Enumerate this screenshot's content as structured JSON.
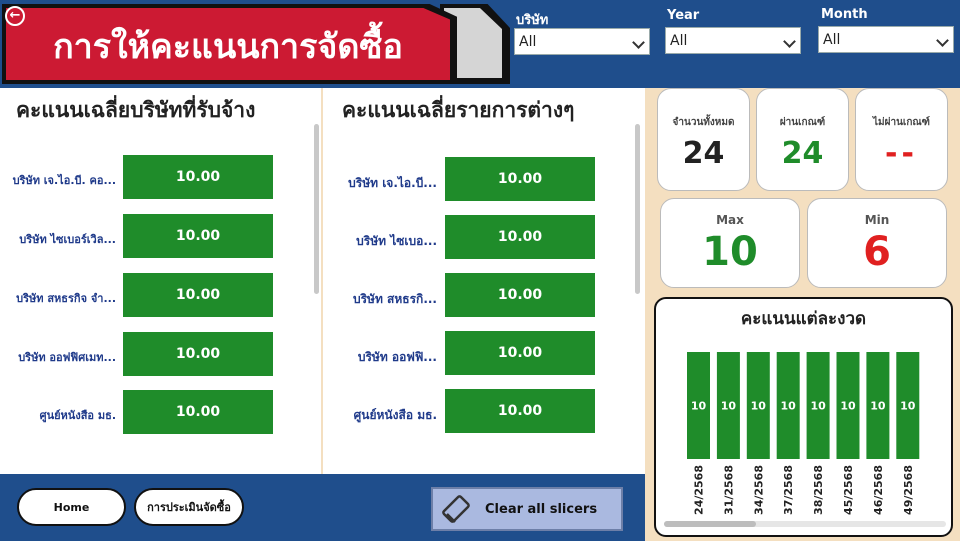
{
  "header": {
    "title": "การให้คะแนนการจัดซื้อ",
    "colors": {
      "band": "#1f4e8c",
      "title_bg": "#cc1a33"
    }
  },
  "filters": [
    {
      "label": "บริษัท",
      "value": "All"
    },
    {
      "label": "Year",
      "value": "All"
    },
    {
      "label": "Month",
      "value": "All"
    }
  ],
  "left_table": {
    "title": "คะแนนเฉลี่ยบริษัทที่รับจ้าง",
    "rows": [
      {
        "label": "บริษัท เจ.ไอ.บี. คอ...",
        "value": "10.00"
      },
      {
        "label": "บริษัท ไซเบอร์เวิล...",
        "value": "10.00"
      },
      {
        "label": "บริษัท สหธรกิจ จำ...",
        "value": "10.00"
      },
      {
        "label": "บริษัท ออฟฟิศเมท...",
        "value": "10.00"
      },
      {
        "label": "ศูนย์หนังสือ มธ.",
        "value": "10.00"
      }
    ]
  },
  "right_table": {
    "title": "คะแนนเฉลี่ยรายการต่างๆ",
    "rows": [
      {
        "label": "บริษัท เจ.ไอ.บี...",
        "value": "10.00"
      },
      {
        "label": "บริษัท ไซเบอ...",
        "value": "10.00"
      },
      {
        "label": "บริษัท สหธรกิ...",
        "value": "10.00"
      },
      {
        "label": "บริษัท ออฟฟิ...",
        "value": "10.00"
      },
      {
        "label": "ศูนย์หนังสือ มธ.",
        "value": "10.00"
      }
    ]
  },
  "nav": {
    "home": "Home",
    "evaluation": "การประเมินจัดซื้อ",
    "clear": "Clear all slicers"
  },
  "kpis": {
    "total": {
      "label": "จำนวนทั้งหมด",
      "value": "24",
      "color": "#222222"
    },
    "pass": {
      "label": "ผ่านเกณฑ์",
      "value": "24",
      "color": "#1f8c2a"
    },
    "fail": {
      "label": "ไม่ผ่านเกณฑ์",
      "value": "--",
      "color": "#e02020"
    },
    "max": {
      "label": "Max",
      "value": "10",
      "color": "#1f8c2a"
    },
    "min": {
      "label": "Min",
      "value": "6",
      "color": "#e02020"
    }
  },
  "chart_data": {
    "type": "bar",
    "title": "คะแนนแต่ละงวด",
    "categories": [
      "24/2568",
      "31/2568",
      "34/2568",
      "37/2568",
      "38/2568",
      "45/2568",
      "46/2568",
      "49/2568"
    ],
    "values": [
      10,
      10,
      10,
      10,
      10,
      10,
      10,
      10
    ],
    "data_labels": [
      "10",
      "10",
      "10",
      "10",
      "10",
      "10",
      "10",
      "10"
    ],
    "bar_color": "#1f8c2a",
    "ylim": [
      0,
      10
    ],
    "grid": false
  }
}
